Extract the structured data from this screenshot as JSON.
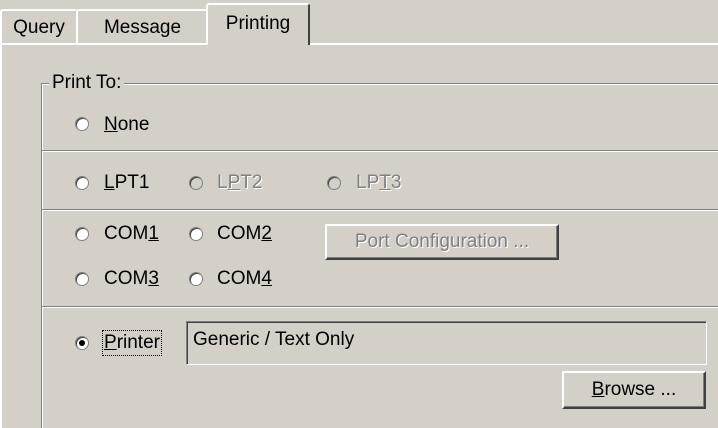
{
  "tabs": [
    {
      "label": "Query"
    },
    {
      "label": "Message"
    },
    {
      "label": "Printing"
    }
  ],
  "group": {
    "legend": "Print To:"
  },
  "options": {
    "none": {
      "pre": "",
      "key": "N",
      "post": "one",
      "selected": false
    },
    "lpt1": {
      "pre": "",
      "key": "L",
      "post": "PT1",
      "selected": false
    },
    "lpt2": {
      "pre": "L",
      "key": "P",
      "post": "T2",
      "selected": false
    },
    "lpt3": {
      "pre": "LP",
      "key": "T",
      "post": "3",
      "selected": false
    },
    "com1": {
      "pre": "COM",
      "key": "1",
      "post": "",
      "selected": false
    },
    "com2": {
      "pre": "COM",
      "key": "2",
      "post": "",
      "selected": false
    },
    "com3": {
      "pre": "COM",
      "key": "3",
      "post": "",
      "selected": false
    },
    "com4": {
      "pre": "COM",
      "key": "4",
      "post": "",
      "selected": false
    },
    "printer": {
      "pre": "",
      "key": "P",
      "post": "rinter",
      "selected": true
    }
  },
  "port_config": {
    "label": "Port Configuration ..."
  },
  "printer_field": {
    "value": "Generic / Text Only"
  },
  "browse": {
    "key": "B",
    "post": "rowse ..."
  },
  "colors": {
    "face": "#d4d0c8",
    "disabled_text": "#808080"
  }
}
